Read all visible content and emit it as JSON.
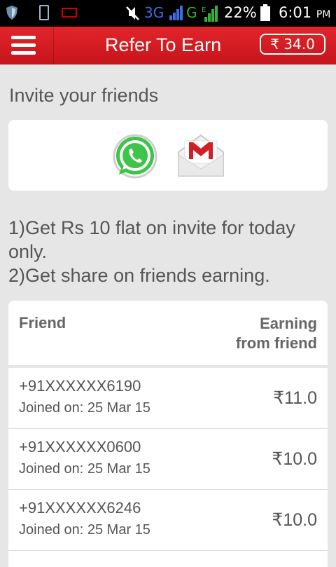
{
  "status_bar": {
    "network_3g": "3G",
    "network_g": "G",
    "battery_percent": "22%",
    "time": "6:01",
    "ampm": "PM"
  },
  "app_bar": {
    "title": "Refer To Earn",
    "balance": "₹ 34.0"
  },
  "invite": {
    "title": "Invite your friends",
    "share_apps": [
      "whatsapp-icon",
      "gmail-icon"
    ]
  },
  "offers": {
    "line1": "1)Get Rs 10 flat on invite for today only.",
    "line2": "2)Get share on friends earning."
  },
  "table": {
    "col_friend": "Friend",
    "col_earning_1": "Earning",
    "col_earning_2": "from friend",
    "rows": [
      {
        "phone": "+91XXXXXX6190",
        "joined": "Joined on: 25 Mar 15",
        "earning": "₹11.0"
      },
      {
        "phone": "+91XXXXXX0600",
        "joined": "Joined on: 25 Mar 15",
        "earning": "₹10.0"
      },
      {
        "phone": "+91XXXXXX6246",
        "joined": "Joined on: 25 Mar 15",
        "earning": "₹10.0"
      }
    ]
  },
  "colors": {
    "app_bar": "#d51c22",
    "background": "#e6e6e6",
    "whatsapp": "#3ec449",
    "gmail_red": "#d21f26"
  }
}
